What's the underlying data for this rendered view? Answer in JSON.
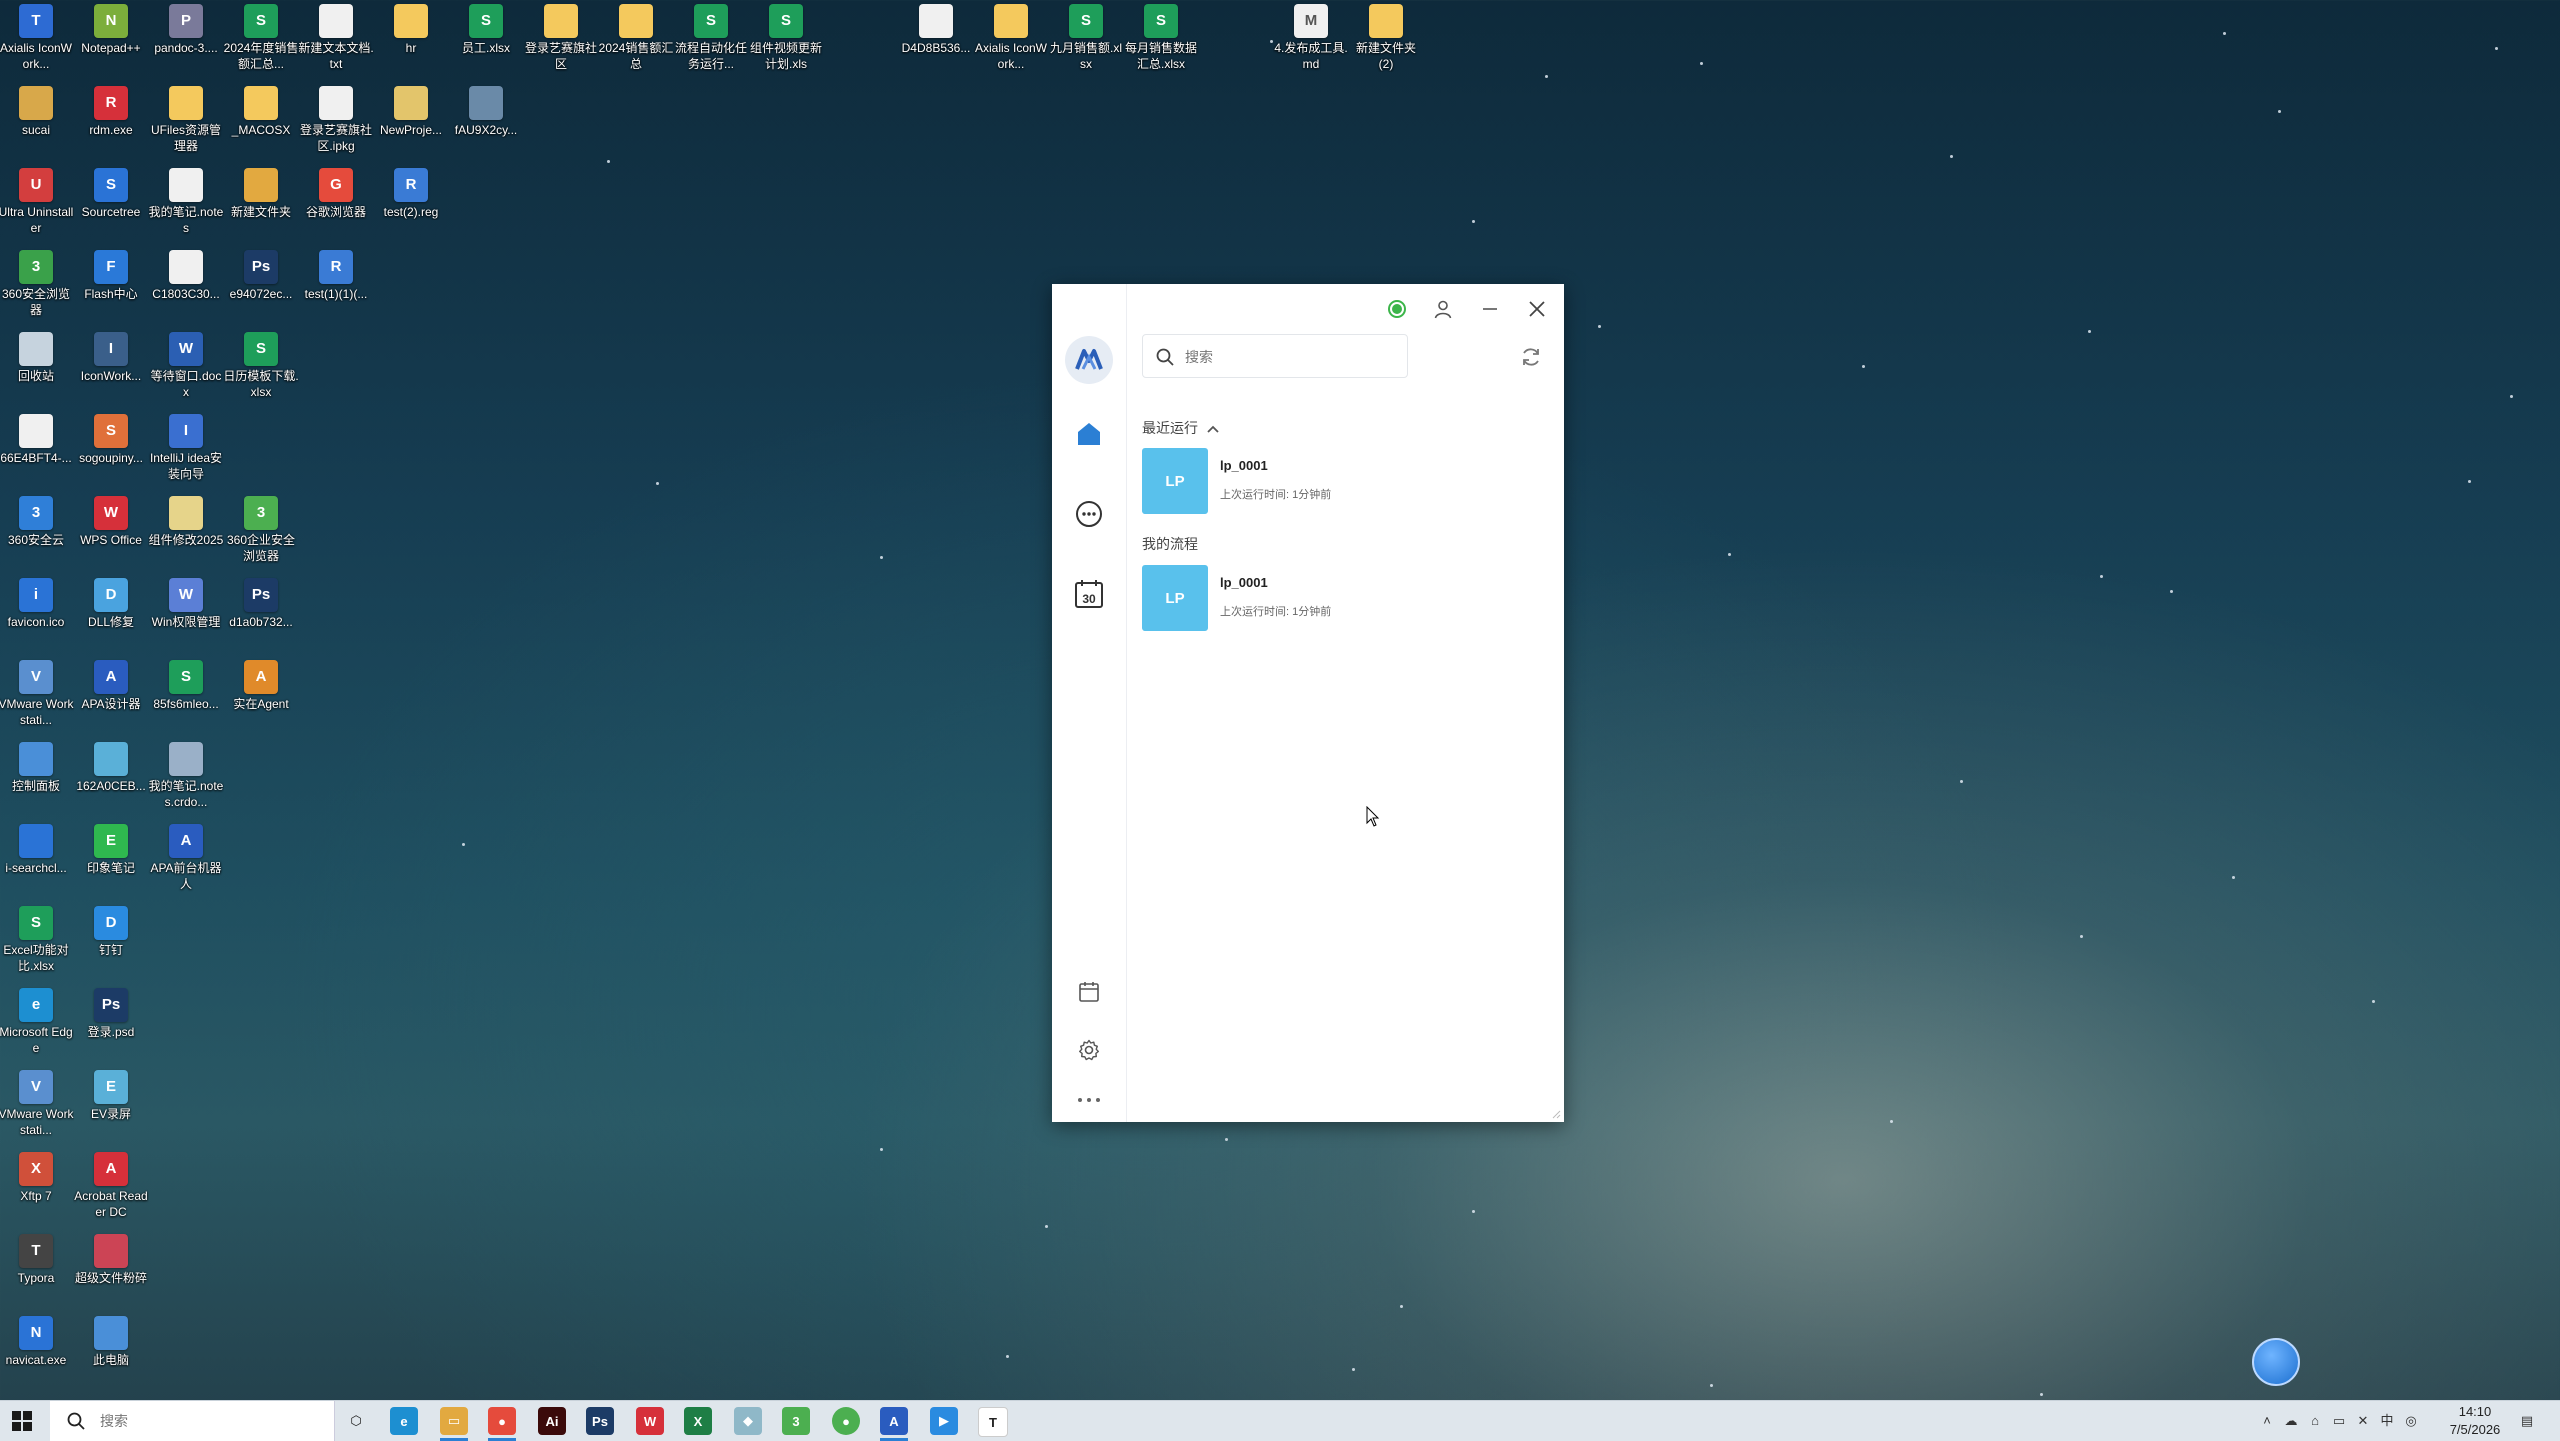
{
  "desktop": {
    "icons": [
      {
        "label": "Axialis IconWork...",
        "glyph": "T",
        "color": "#2d6bd3"
      },
      {
        "label": "Notepad++",
        "glyph": "N",
        "color": "#7cae3b"
      },
      {
        "label": "pandoc-3....",
        "glyph": "P",
        "color": "#7a7a9a"
      },
      {
        "label": "2024年度销售额汇总...",
        "glyph": "S",
        "color": "#1e9e5a"
      },
      {
        "label": "新建文本文档.txt",
        "glyph": "",
        "color": "#f0f0f0"
      },
      {
        "label": "hr",
        "glyph": "",
        "color": "#f4c95d"
      },
      {
        "label": "员工.xlsx",
        "glyph": "S",
        "color": "#1e9e5a"
      },
      {
        "label": "登录艺赛旗社区",
        "glyph": "",
        "color": "#f4c95d"
      },
      {
        "label": "2024销售额汇总",
        "glyph": "",
        "color": "#f4c95d"
      },
      {
        "label": "流程自动化任务运行...",
        "glyph": "S",
        "color": "#1e9e5a"
      },
      {
        "label": "组件视频更新计划.xls",
        "glyph": "S",
        "color": "#1e9e5a"
      },
      {
        "label": "D4D8B536...",
        "glyph": "",
        "color": "#f0f0f0"
      },
      {
        "label": "Axialis IconWork...",
        "glyph": "",
        "color": "#f4c95d"
      },
      {
        "label": "九月销售额.xlsx",
        "glyph": "S",
        "color": "#1e9e5a"
      },
      {
        "label": "每月销售数据汇总.xlsx",
        "glyph": "S",
        "color": "#1e9e5a"
      },
      {
        "label": "4.发布成工具.md",
        "glyph": "M",
        "color": "#f0f0f0"
      },
      {
        "label": "新建文件夹 (2)",
        "glyph": "",
        "color": "#f4c95d"
      },
      {
        "label": "sucai",
        "glyph": "",
        "color": "#d8a84a"
      },
      {
        "label": "rdm.exe",
        "glyph": "R",
        "color": "#d6303a"
      },
      {
        "label": "UFiles资源管理器",
        "glyph": "",
        "color": "#f4c95d"
      },
      {
        "label": "_MACOSX",
        "glyph": "",
        "color": "#f4c95d"
      },
      {
        "label": "登录艺赛旗社区.ipkg",
        "glyph": "",
        "color": "#f0f0f0"
      },
      {
        "label": "NewProje...",
        "glyph": "",
        "color": "#e3c56b"
      },
      {
        "label": "fAU9X2cy...",
        "glyph": "",
        "color": "#6a8aa8"
      },
      {
        "label": "Ultra Uninstaller",
        "glyph": "U",
        "color": "#d33e3e"
      },
      {
        "label": "Sourcetree",
        "glyph": "S",
        "color": "#2a73d6"
      },
      {
        "label": "我的笔记.notes",
        "glyph": "",
        "color": "#f0f0f0"
      },
      {
        "label": "新建文件夹",
        "glyph": "",
        "color": "#e2a940"
      },
      {
        "label": "谷歌浏览器",
        "glyph": "G",
        "color": "#e54b3c"
      },
      {
        "label": "test(2).reg",
        "glyph": "R",
        "color": "#3a7bd5"
      },
      {
        "label": "360安全浏览器",
        "glyph": "3",
        "color": "#3aa14a"
      },
      {
        "label": "Flash中心",
        "glyph": "F",
        "color": "#2a79d8"
      },
      {
        "label": "C1803C30...",
        "glyph": "",
        "color": "#f0f0f0"
      },
      {
        "label": "e94072ec...",
        "glyph": "Ps",
        "color": "#1c3b66"
      },
      {
        "label": "test(1)(1)(...",
        "glyph": "R",
        "color": "#3a7bd5"
      },
      {
        "label": "回收站",
        "glyph": "",
        "color": "#c6d3de"
      },
      {
        "label": "IconWork...",
        "glyph": "I",
        "color": "#3a5f8a"
      },
      {
        "label": "等待窗口.docx",
        "glyph": "W",
        "color": "#2b5fb3"
      },
      {
        "label": "日历模板下载.xlsx",
        "glyph": "S",
        "color": "#1e9e5a"
      },
      {
        "label": "66E4BFT4-...",
        "glyph": "",
        "color": "#f0f0f0"
      },
      {
        "label": "sogoupiny...",
        "glyph": "S",
        "color": "#e0703a"
      },
      {
        "label": "IntelliJ idea安装向导",
        "glyph": "I",
        "color": "#3a6fd0"
      },
      {
        "label": "360安全云",
        "glyph": "3",
        "color": "#2f7fd8"
      },
      {
        "label": "WPS Office",
        "glyph": "W",
        "color": "#d6303a"
      },
      {
        "label": "组件修改2025",
        "glyph": "",
        "color": "#e6d48a"
      },
      {
        "label": "360企业安全浏览器",
        "glyph": "3",
        "color": "#4caf50"
      },
      {
        "label": "favicon.ico",
        "glyph": "i",
        "color": "#2a73d6"
      },
      {
        "label": "DLL修复",
        "glyph": "D",
        "color": "#4aa3df"
      },
      {
        "label": "Win权限管理",
        "glyph": "W",
        "color": "#5b7fd6"
      },
      {
        "label": "d1a0b732...",
        "glyph": "Ps",
        "color": "#1c3b66"
      },
      {
        "label": "VMware Workstati...",
        "glyph": "V",
        "color": "#5a8fcf"
      },
      {
        "label": "APA设计器",
        "glyph": "A",
        "color": "#2a5cbf"
      },
      {
        "label": "85fs6mleo...",
        "glyph": "S",
        "color": "#1e9e5a"
      },
      {
        "label": "实在Agent",
        "glyph": "A",
        "color": "#e08a2a"
      },
      {
        "label": "控制面板",
        "glyph": "",
        "color": "#4a8fd8"
      },
      {
        "label": "162A0CEB...",
        "glyph": "",
        "color": "#5ab0d8"
      },
      {
        "label": "我的笔记.notes.crdo...",
        "glyph": "",
        "color": "#9ab0c8"
      },
      {
        "label": "i-searchcl...",
        "glyph": "",
        "color": "#2a73d6"
      },
      {
        "label": "印象笔记",
        "glyph": "E",
        "color": "#2fb84f"
      },
      {
        "label": "APA前台机器人",
        "glyph": "A",
        "color": "#2a5cbf"
      },
      {
        "label": "Excel功能对比.xlsx",
        "glyph": "S",
        "color": "#1e9e5a"
      },
      {
        "label": "钉钉",
        "glyph": "D",
        "color": "#2a8be0"
      },
      {
        "label": "Microsoft Edge",
        "glyph": "e",
        "color": "#1d8fd1"
      },
      {
        "label": "登录.psd",
        "glyph": "Ps",
        "color": "#1c3b66"
      },
      {
        "label": "VMware Workstati...",
        "glyph": "V",
        "color": "#5a8fcf"
      },
      {
        "label": "EV录屏",
        "glyph": "E",
        "color": "#5ab0d8"
      },
      {
        "label": "Xftp 7",
        "glyph": "X",
        "color": "#d0503a"
      },
      {
        "label": "Acrobat Reader DC",
        "glyph": "A",
        "color": "#d6303a"
      },
      {
        "label": "Typora",
        "glyph": "T",
        "color": "#444444"
      },
      {
        "label": "超级文件粉碎",
        "glyph": "",
        "color": "#cc4455"
      },
      {
        "label": "navicat.exe",
        "glyph": "N",
        "color": "#2a73d6"
      },
      {
        "label": "此电脑",
        "glyph": "",
        "color": "#4a8fd8"
      }
    ]
  },
  "app": {
    "search_placeholder": "搜索",
    "recent_label": "最近运行",
    "my_flows_label": "我的流程",
    "recent_items": [
      {
        "avatar": "LP",
        "name": "lp_0001",
        "time": "上次运行时间:  1分钟前"
      }
    ],
    "my_flows": [
      {
        "avatar": "LP",
        "name": "lp_0001",
        "time": "上次运行时间:  1分钟前"
      }
    ],
    "calendar_day": "30",
    "status_color": "#3cb54a",
    "accent_color": "#2b7fd4"
  },
  "taskbar": {
    "search_placeholder": "搜索",
    "time": "14:10",
    "date": "7/5/2026"
  }
}
